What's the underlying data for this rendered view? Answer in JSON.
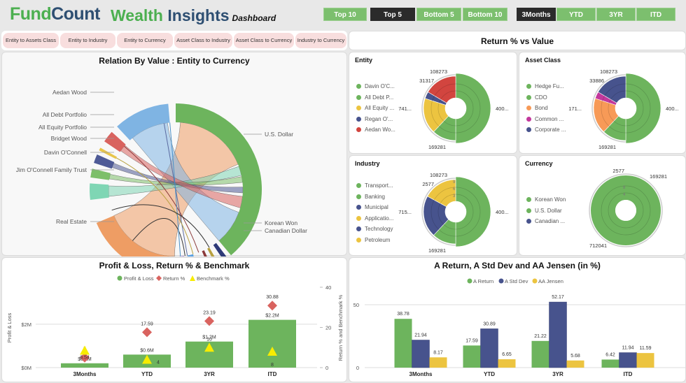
{
  "header": {
    "logo_part1": "Fund",
    "logo_part2": "Count",
    "title_part1": "Wealth",
    "title_part2": "Insights",
    "title_suffix": "Dashboard"
  },
  "rank_filters": [
    {
      "label": "Top 10",
      "active": false
    },
    {
      "label": "Top 5",
      "active": true
    },
    {
      "label": "Bottom 5",
      "active": false
    },
    {
      "label": "Bottom 10",
      "active": false
    }
  ],
  "period_filters": [
    {
      "label": "3Months",
      "active": true
    },
    {
      "label": "YTD",
      "active": false
    },
    {
      "label": "3YR",
      "active": false
    },
    {
      "label": "ITD",
      "active": false
    }
  ],
  "relation_tabs": [
    "Entity to Assets Class",
    "Entity to Industry",
    "Entity to Currency",
    "Asset Class to Industry",
    "Asset Class to Currency",
    "Industry to Currency"
  ],
  "chord": {
    "title": "Relation By Value :   Entity to Currency",
    "left_labels": [
      "Aedan Wood",
      "All Debt Portfolio",
      "All Equity Portfolio",
      "Bridget Wood",
      "Davin O'Connell",
      "Jim O'Connell Family Trust",
      "Real Estate"
    ],
    "right_labels": [
      "U.S. Dollar",
      "Korean Won",
      "Canadian Dollar"
    ],
    "colors": {
      "Aedan Wood": "#7fb4e3",
      "All Debt Portfolio": "#d9635f",
      "All Equity Portfolio": "#e8c54a",
      "Bridget Wood": "#4e5a96",
      "Davin O'Connell": "#7dbf6a",
      "Jim O'Connell Family Trust": "#7fd6b4",
      "Real Estate": "#ee9d64",
      "U.S. Dollar": "#6db45d"
    }
  },
  "return_vs_value": {
    "title": "Return % vs Value",
    "panels": [
      {
        "title": "Entity",
        "legend": [
          {
            "label": "Davin O'C...",
            "color": "#6db45d"
          },
          {
            "label": "All Debt P...",
            "color": "#6db45d"
          },
          {
            "label": "All Equity ...",
            "color": "#ecc440"
          },
          {
            "label": "Regan O'...",
            "color": "#47538d"
          },
          {
            "label": "Aedan Wo...",
            "color": "#d2453f"
          }
        ],
        "labels": {
          "top": "108273",
          "upper_left": "31317",
          "left": "741...",
          "right": "400...",
          "bottom": "169281"
        },
        "slices": [
          {
            "color": "#6db45d",
            "from": 0,
            "to": 0.5
          },
          {
            "color": "#6db45d",
            "from": 0.5,
            "to": 0.62
          },
          {
            "color": "#ecc440",
            "from": 0.62,
            "to": 0.8
          },
          {
            "color": "#47538d",
            "from": 0.8,
            "to": 0.835
          },
          {
            "color": "#d2453f",
            "from": 0.835,
            "to": 1.0
          }
        ]
      },
      {
        "title": "Asset Class",
        "legend": [
          {
            "label": "Hedge Fu...",
            "color": "#6db45d"
          },
          {
            "label": "CDO",
            "color": "#6db45d"
          },
          {
            "label": "Bond",
            "color": "#f79a57"
          },
          {
            "label": "Common ...",
            "color": "#c3389c"
          },
          {
            "label": "Corporate ...",
            "color": "#47538d"
          }
        ],
        "labels": {
          "top": "108273",
          "upper_left": "33886",
          "left": "171...",
          "right": "400...",
          "bottom": "169281"
        },
        "slices": [
          {
            "color": "#6db45d",
            "from": 0,
            "to": 0.5
          },
          {
            "color": "#6db45d",
            "from": 0.5,
            "to": 0.62
          },
          {
            "color": "#f79a57",
            "from": 0.62,
            "to": 0.8
          },
          {
            "color": "#c3389c",
            "from": 0.8,
            "to": 0.835
          },
          {
            "color": "#47538d",
            "from": 0.835,
            "to": 1.0
          }
        ]
      },
      {
        "title": "Industry",
        "legend": [
          {
            "label": "Transport...",
            "color": "#6db45d"
          },
          {
            "label": "Banking",
            "color": "#6db45d"
          },
          {
            "label": "Municipal",
            "color": "#47538d"
          },
          {
            "label": "Applicatio...",
            "color": "#ecc440"
          },
          {
            "label": "Technology",
            "color": "#47538d"
          },
          {
            "label": "Petroleum",
            "color": "#ecc440"
          }
        ],
        "labels": {
          "top": "108273",
          "upper_left": "2577",
          "left": "715...",
          "right": "400...",
          "bottom": "169281"
        },
        "slices": [
          {
            "color": "#6db45d",
            "from": 0,
            "to": 0.5
          },
          {
            "color": "#6db45d",
            "from": 0.5,
            "to": 0.62
          },
          {
            "color": "#47538d",
            "from": 0.62,
            "to": 0.83
          },
          {
            "color": "#ecc440",
            "from": 0.83,
            "to": 1.0
          }
        ],
        "ring_ticks": [
          "3",
          "6",
          "9"
        ]
      },
      {
        "title": "Currency",
        "legend": [
          {
            "label": "Korean Won",
            "color": "#6db45d"
          },
          {
            "label": "U.S. Dollar",
            "color": "#6db45d"
          },
          {
            "label": "Canadian ...",
            "color": "#47538d"
          }
        ],
        "labels": {
          "top": "2577",
          "right": "169281",
          "bottom": "712041"
        },
        "slices": [
          {
            "color": "#6db45d",
            "from": 0,
            "to": 1.0
          }
        ],
        "ring_ticks": [
          "4",
          "8"
        ]
      }
    ]
  },
  "chart_data": [
    {
      "type": "bar",
      "title": "Profit & Loss, Return % & Benchmark",
      "categories": [
        "3Months",
        "YTD",
        "3YR",
        "ITD"
      ],
      "series": [
        {
          "name": "Profit & Loss",
          "kind": "bar",
          "axis": "left",
          "values": [
            0.2,
            0.6,
            1.2,
            2.2
          ],
          "labels": [
            "$0.2M",
            "$0.6M",
            "$1.2M",
            "$2.2M"
          ],
          "color": "#6db45d"
        },
        {
          "name": "Return %",
          "kind": "diamond",
          "axis": "right",
          "values": [
            5,
            17.59,
            23.19,
            30.88
          ],
          "labels": [
            "5",
            "17.59",
            "23.19",
            "30.88"
          ],
          "color": "#d9635f"
        },
        {
          "name": "Benchmark %",
          "kind": "triangle",
          "axis": "right",
          "values": [
            8.54,
            4,
            10,
            8
          ],
          "labels": [
            "8.54",
            "4",
            "10",
            "8"
          ],
          "color": "#f7ec00"
        }
      ],
      "ylabel": "Profit & Loss",
      "y2label": "Return % and Benchmark %",
      "yticks": [
        "$0M",
        "$2M"
      ],
      "ylim": [
        0,
        3.7
      ],
      "y2ticks": [
        "0",
        "20",
        "40"
      ],
      "y2lim": [
        0,
        40
      ],
      "legend": "top"
    },
    {
      "type": "bar",
      "title": "A Return, A Std Dev and AA Jensen  (in %)",
      "categories": [
        "3Months",
        "YTD",
        "3YR",
        "ITD"
      ],
      "series": [
        {
          "name": "A Return",
          "values": [
            38.78,
            17.59,
            21.22,
            6.42
          ],
          "color": "#6db45d"
        },
        {
          "name": "A Std Dev",
          "values": [
            21.94,
            30.89,
            52.17,
            11.94
          ],
          "color": "#47538d"
        },
        {
          "name": "AA Jensen",
          "values": [
            8.17,
            6.65,
            5.68,
            11.59
          ],
          "color": "#ecc440"
        }
      ],
      "yticks": [
        "0",
        "50"
      ],
      "ylim": [
        0,
        50
      ],
      "legend": "top"
    }
  ]
}
